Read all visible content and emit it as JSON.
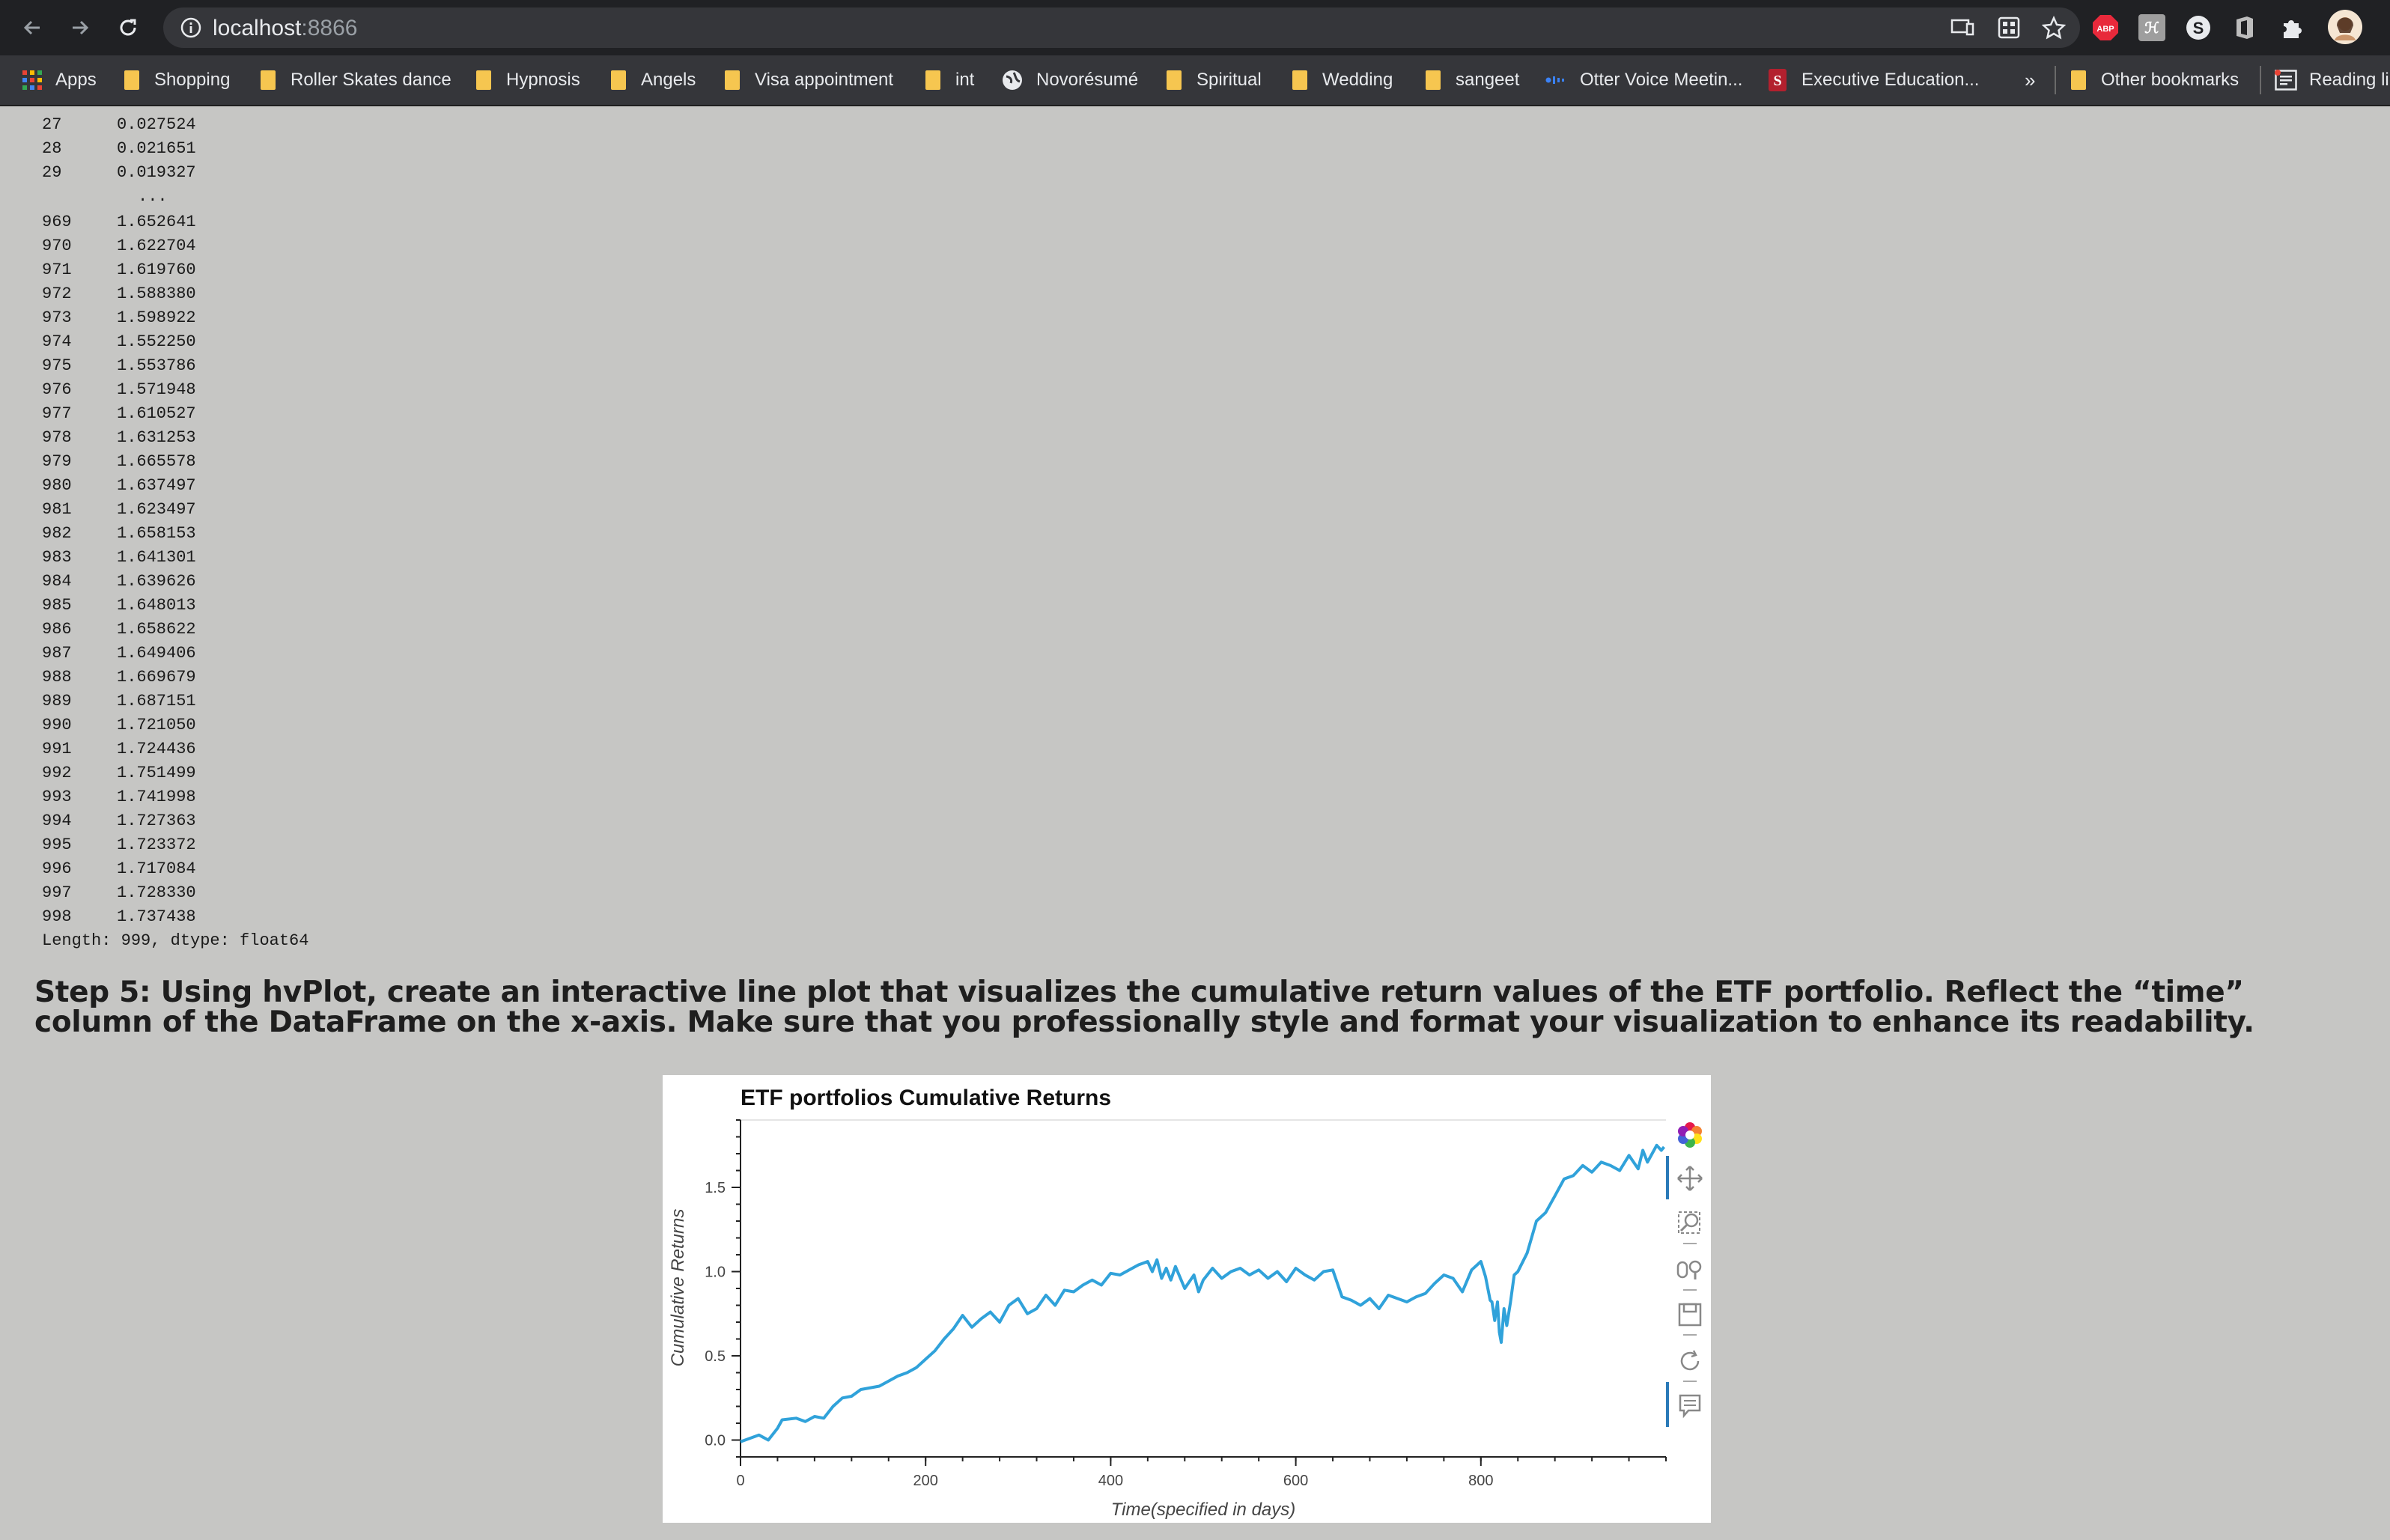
{
  "browser": {
    "url_host": "localhost",
    "url_port": ":8866",
    "icons": {
      "back": "arrow-left-icon",
      "forward": "arrow-right-icon",
      "reload": "reload-icon",
      "info": "info-icon",
      "cast": "cast-icon",
      "grid": "app-grid-icon",
      "star": "star-icon",
      "abp": "ABP",
      "extensions": "puzzle-icon",
      "avatar": "avatar-icon"
    }
  },
  "bookmarks": {
    "items": [
      {
        "label": "Apps",
        "icon": "apps-grid-icon"
      },
      {
        "label": "Shopping",
        "icon": "folder-icon"
      },
      {
        "label": "Roller Skates dance",
        "icon": "folder-icon"
      },
      {
        "label": "Hypnosis",
        "icon": "folder-icon"
      },
      {
        "label": "Angels",
        "icon": "folder-icon"
      },
      {
        "label": "Visa appointment",
        "icon": "folder-icon"
      },
      {
        "label": "int",
        "icon": "folder-icon"
      },
      {
        "label": "Novorésumé",
        "icon": "globe-icon"
      },
      {
        "label": "Spiritual",
        "icon": "folder-icon"
      },
      {
        "label": "Wedding",
        "icon": "folder-icon"
      },
      {
        "label": "sangeet",
        "icon": "folder-icon"
      },
      {
        "label": "Otter Voice Meetin...",
        "icon": "otter-icon"
      },
      {
        "label": "Executive Education...",
        "icon": "s-logo-icon"
      }
    ],
    "overflow": "»",
    "other": "Other bookmarks",
    "reading": "Reading li"
  },
  "output": {
    "top_rows": [
      {
        "idx": "27",
        "val": "0.027524"
      },
      {
        "idx": "28",
        "val": "0.021651"
      },
      {
        "idx": "29",
        "val": "0.019327"
      }
    ],
    "ellipsis": "...",
    "rows": [
      {
        "idx": "969",
        "val": "1.652641"
      },
      {
        "idx": "970",
        "val": "1.622704"
      },
      {
        "idx": "971",
        "val": "1.619760"
      },
      {
        "idx": "972",
        "val": "1.588380"
      },
      {
        "idx": "973",
        "val": "1.598922"
      },
      {
        "idx": "974",
        "val": "1.552250"
      },
      {
        "idx": "975",
        "val": "1.553786"
      },
      {
        "idx": "976",
        "val": "1.571948"
      },
      {
        "idx": "977",
        "val": "1.610527"
      },
      {
        "idx": "978",
        "val": "1.631253"
      },
      {
        "idx": "979",
        "val": "1.665578"
      },
      {
        "idx": "980",
        "val": "1.637497"
      },
      {
        "idx": "981",
        "val": "1.623497"
      },
      {
        "idx": "982",
        "val": "1.658153"
      },
      {
        "idx": "983",
        "val": "1.641301"
      },
      {
        "idx": "984",
        "val": "1.639626"
      },
      {
        "idx": "985",
        "val": "1.648013"
      },
      {
        "idx": "986",
        "val": "1.658622"
      },
      {
        "idx": "987",
        "val": "1.649406"
      },
      {
        "idx": "988",
        "val": "1.669679"
      },
      {
        "idx": "989",
        "val": "1.687151"
      },
      {
        "idx": "990",
        "val": "1.721050"
      },
      {
        "idx": "991",
        "val": "1.724436"
      },
      {
        "idx": "992",
        "val": "1.751499"
      },
      {
        "idx": "993",
        "val": "1.741998"
      },
      {
        "idx": "994",
        "val": "1.727363"
      },
      {
        "idx": "995",
        "val": "1.723372"
      },
      {
        "idx": "996",
        "val": "1.717084"
      },
      {
        "idx": "997",
        "val": "1.728330"
      },
      {
        "idx": "998",
        "val": "1.737438"
      }
    ],
    "length_line": "Length: 999, dtype: float64"
  },
  "step5": "Step 5: Using hvPlot, create an interactive line plot that visualizes the cumulative return values of the ETF portfolio. Reflect the “time” column of the DataFrame on the x-axis. Make sure that you professionally style and format your visualization to enhance its readability.",
  "plot_tools": [
    "bokeh-logo-icon",
    "pan-icon",
    "box-zoom-icon",
    "wheel-zoom-icon",
    "save-icon",
    "reset-icon",
    "hover-icon"
  ],
  "chart_data": {
    "type": "line",
    "title": "ETF portfolios Cumulative Returns",
    "xlabel": "Time(specified in days)",
    "ylabel": "Cumulative Returns",
    "xlim": [
      0,
      1000
    ],
    "ylim": [
      -0.1,
      1.9
    ],
    "xticks": [
      0,
      200,
      400,
      600,
      800
    ],
    "yticks": [
      0.0,
      0.5,
      1.0,
      1.5
    ],
    "color": "#30a2da",
    "grid": false,
    "series": [
      {
        "x": [
          0,
          20,
          30,
          40,
          45,
          60,
          70,
          80,
          90,
          100,
          110,
          120,
          130,
          150,
          160,
          170,
          180,
          190,
          200,
          210,
          220,
          230,
          240,
          250,
          260,
          270,
          280,
          290,
          300,
          310,
          320,
          330,
          340,
          350,
          360,
          370,
          380,
          390,
          400,
          410,
          420,
          430,
          440,
          445,
          450,
          455,
          460,
          465,
          470,
          480,
          490,
          495,
          500,
          510,
          520,
          530,
          540,
          550,
          560,
          570,
          580,
          590,
          600,
          610,
          620,
          630,
          640,
          650,
          660,
          670,
          680,
          690,
          700,
          710,
          720,
          730,
          740,
          750,
          760,
          770,
          780,
          790,
          800,
          805,
          810,
          812,
          815,
          818,
          820,
          822,
          825,
          828,
          832,
          836,
          840,
          850,
          860,
          870,
          880,
          890,
          900,
          910,
          920,
          930,
          940,
          950,
          960,
          970,
          975,
          980,
          985,
          990,
          995,
          998
        ],
        "y": [
          -0.01,
          0.03,
          0.0,
          0.07,
          0.12,
          0.13,
          0.11,
          0.14,
          0.13,
          0.2,
          0.25,
          0.26,
          0.3,
          0.32,
          0.35,
          0.38,
          0.4,
          0.43,
          0.48,
          0.53,
          0.6,
          0.66,
          0.74,
          0.67,
          0.72,
          0.76,
          0.7,
          0.8,
          0.84,
          0.75,
          0.78,
          0.86,
          0.8,
          0.89,
          0.88,
          0.92,
          0.95,
          0.92,
          0.99,
          0.98,
          1.01,
          1.04,
          1.06,
          1.0,
          1.07,
          0.96,
          1.02,
          0.95,
          1.03,
          0.9,
          0.98,
          0.88,
          0.95,
          1.02,
          0.96,
          1.0,
          1.02,
          0.98,
          1.01,
          0.96,
          1.0,
          0.94,
          1.02,
          0.98,
          0.95,
          1.0,
          1.01,
          0.85,
          0.83,
          0.8,
          0.84,
          0.78,
          0.86,
          0.84,
          0.82,
          0.85,
          0.87,
          0.93,
          0.98,
          0.96,
          0.88,
          1.01,
          1.06,
          0.97,
          0.83,
          0.82,
          0.71,
          0.82,
          0.64,
          0.58,
          0.78,
          0.68,
          0.82,
          0.98,
          1.0,
          1.11,
          1.3,
          1.35,
          1.45,
          1.55,
          1.57,
          1.63,
          1.59,
          1.65,
          1.63,
          1.6,
          1.69,
          1.61,
          1.72,
          1.65,
          1.7,
          1.75,
          1.72,
          1.74
        ]
      }
    ]
  }
}
